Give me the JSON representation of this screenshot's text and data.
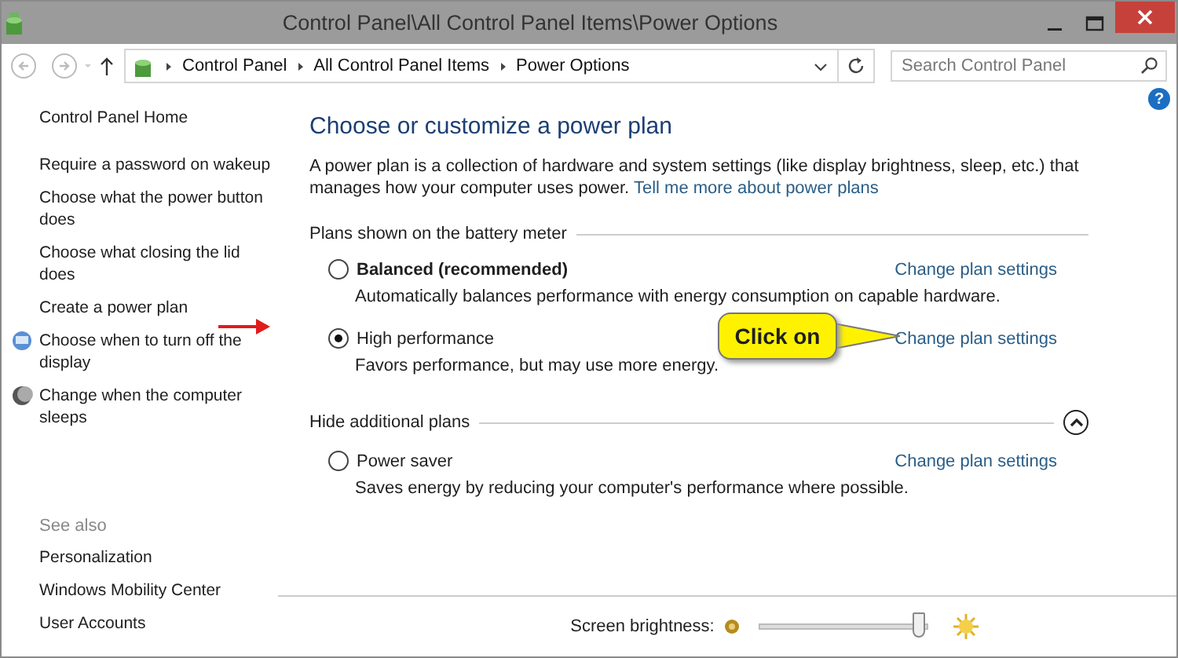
{
  "window": {
    "title": "Control Panel\\All Control Panel Items\\Power Options"
  },
  "address_bar": {
    "crumbs": [
      "Control Panel",
      "All Control Panel Items",
      "Power Options"
    ]
  },
  "search": {
    "placeholder": "Search Control Panel"
  },
  "sidebar": {
    "home": "Control Panel Home",
    "items": [
      "Require a password on wakeup",
      "Choose what the power button does",
      "Choose what closing the lid does",
      "Create a power plan",
      "Choose when to turn off the display",
      "Change when the computer sleeps"
    ],
    "see_also_title": "See also",
    "see_also": [
      "Personalization",
      "Windows Mobility Center",
      "User Accounts"
    ]
  },
  "main": {
    "heading": "Choose or customize a power plan",
    "description": "A power plan is a collection of hardware and system settings (like display brightness, sleep, etc.) that manages how your computer uses power.",
    "link": "Tell me more about power plans",
    "help_button": "?",
    "groups": [
      {
        "title": "Plans shown on the battery meter",
        "collapse_button": false,
        "plans": [
          {
            "name": "Balanced (recommended)",
            "bold": true,
            "selected": false,
            "description": "Automatically balances performance with energy consumption on capable hardware.",
            "link": "Change plan settings"
          },
          {
            "name": "High performance",
            "bold": false,
            "selected": true,
            "description": "Favors performance, but may use more energy.",
            "link": "Change plan settings"
          }
        ]
      },
      {
        "title": "Hide additional plans",
        "collapse_button": true,
        "plans": [
          {
            "name": "Power saver",
            "bold": false,
            "selected": false,
            "description": "Saves energy by reducing your computer's performance where possible.",
            "link": "Change plan settings"
          }
        ]
      }
    ]
  },
  "callout": {
    "text": "Click on"
  },
  "brightness": {
    "label": "Screen brightness:",
    "level": 0.95
  }
}
